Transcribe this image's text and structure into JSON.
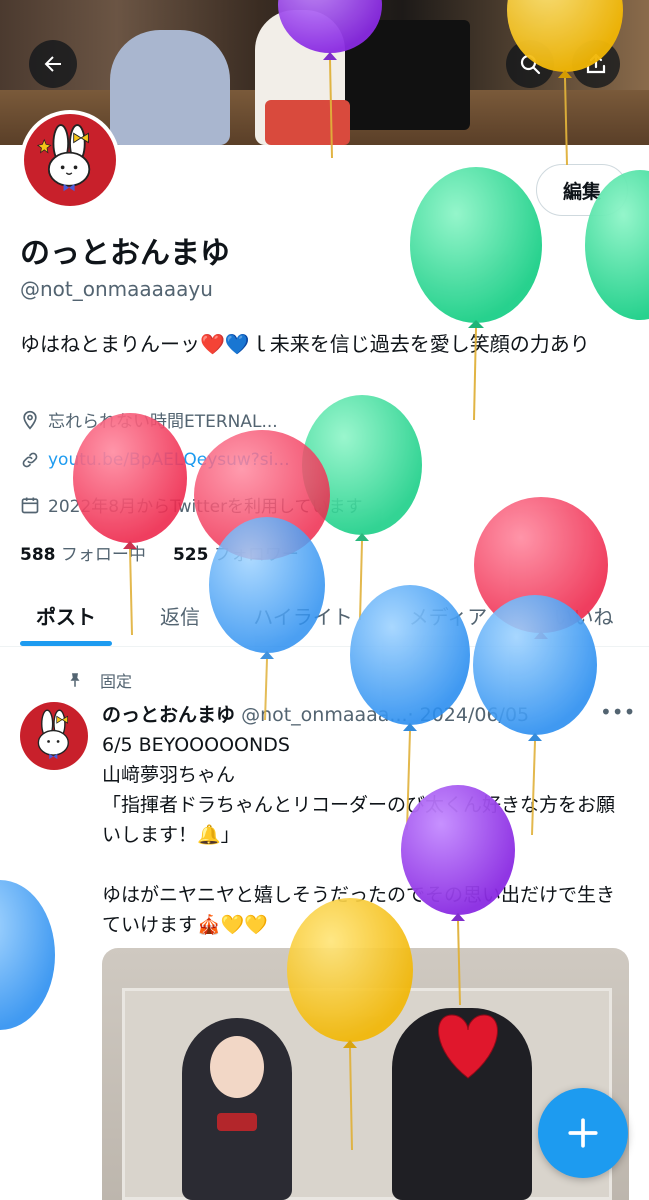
{
  "header": {
    "back_label": "←",
    "search_icon": "search-icon",
    "share_icon": "share-icon"
  },
  "profile": {
    "edit_button": "編集",
    "display_name": "のっとおんまゆ",
    "handle": "@not_onmaaaaayu",
    "bio": "ゆはねとまりんーッ❤️💙ｌ未来を信じ過去を愛し笑顔の力あり",
    "location": "忘れられない時間ETERNAL...",
    "link": "youtu.be/BpAELQeysuw?si...",
    "joined": "2022年8月からTwitterを利用しています",
    "following_count": "588",
    "following_label": "フォロー中",
    "followers_count": "525",
    "followers_label": "フォロワー"
  },
  "tabs": [
    {
      "label": "ポスト",
      "active": true
    },
    {
      "label": "返信",
      "active": false
    },
    {
      "label": "ハイライト",
      "active": false
    },
    {
      "label": "メディア",
      "active": false
    },
    {
      "label": "いいね",
      "active": false
    }
  ],
  "post": {
    "pinned_label": "固定",
    "author_name": "のっとおんまゆ",
    "author_handle": "@not_onmaaaa...",
    "date": "· 2024/06/05",
    "more": "•••",
    "text": "6/5 BEYOOOOONDS\n山﨑夢羽ちゃん\n「指揮者ドラちゃんとリコーダーのび太くん好きな方をお願いします！🔔」\n\nゆはがニヤニヤと嬉しそうだったのでその思い出だけで生きていけます🎪💛💛"
  },
  "fab": {
    "label": "+"
  },
  "colors": {
    "accent": "#1d9bf0",
    "text_primary": "#0f1419",
    "text_secondary": "#536471",
    "avatar_bg": "#c8202b",
    "balloon_purple": "#9b45f0",
    "balloon_yellow": "#f7c61a",
    "balloon_green": "#2fdc9a",
    "balloon_red": "#f23d5c",
    "balloon_blue": "#3fa3f5"
  }
}
